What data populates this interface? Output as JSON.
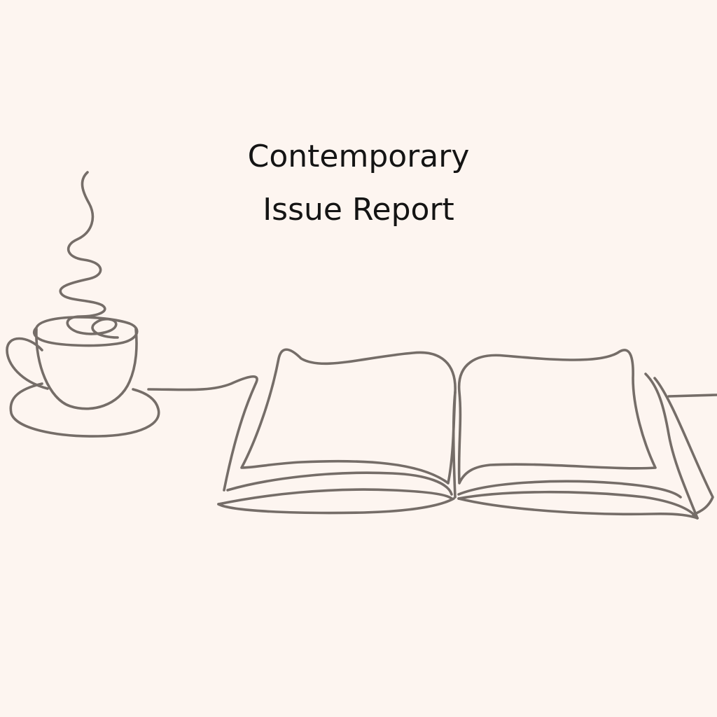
{
  "title_lines": [
    "Contemporary",
    "Issue Report"
  ],
  "colors": {
    "background": "#fdf5f0",
    "line_art": "#756d68",
    "text": "#141414"
  },
  "illustration": {
    "icons": [
      "steaming-cup-icon",
      "open-book-icon"
    ]
  }
}
